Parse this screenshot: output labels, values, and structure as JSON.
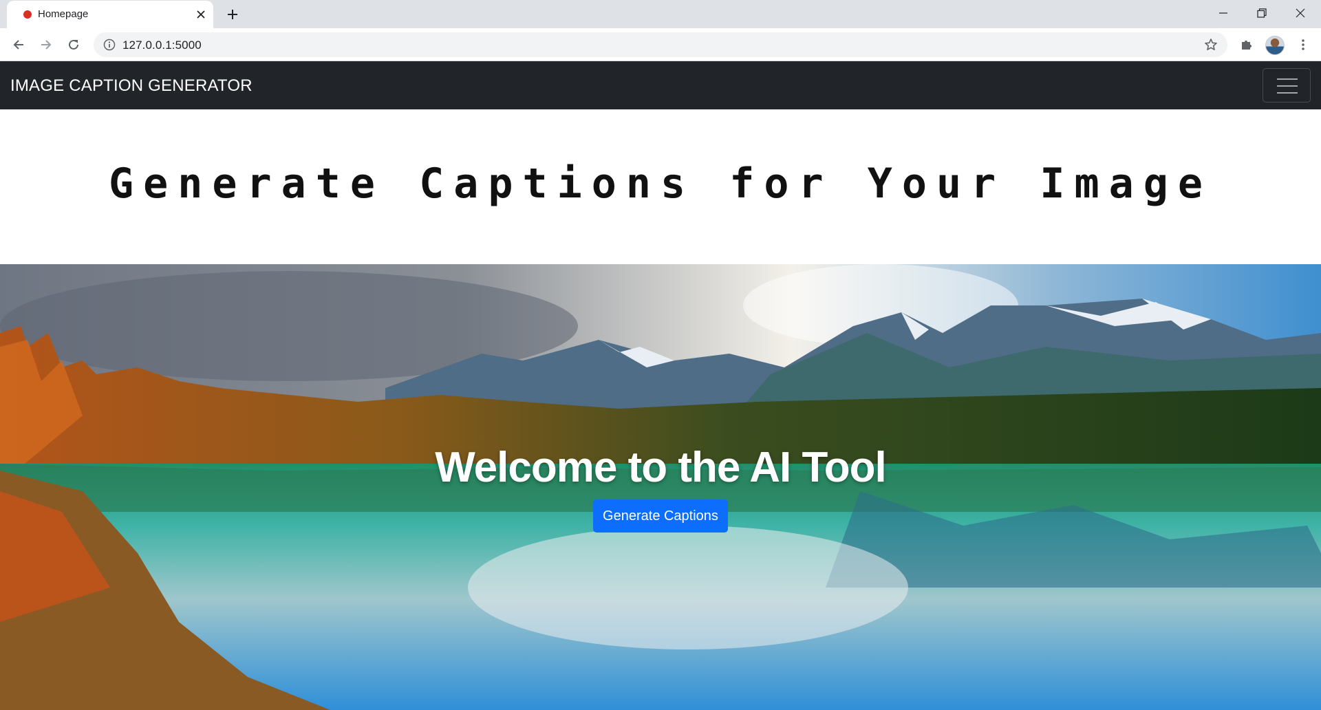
{
  "browser": {
    "tab_title": "Homepage",
    "url": "127.0.0.1:5000"
  },
  "navbar": {
    "brand": "IMAGE CAPTION GENERATOR"
  },
  "main": {
    "heading": "Generate Captions for Your Image"
  },
  "hero": {
    "title": "Welcome to the AI Tool",
    "button_label": "Generate Captions"
  },
  "colors": {
    "navbar_bg": "#212529",
    "button_bg": "#0d6efd",
    "tabstrip_bg": "#dee1e6"
  },
  "icons": {
    "tab_favicon": "red-dot-icon",
    "back": "arrow-left-icon",
    "forward": "arrow-right-icon",
    "reload": "reload-icon",
    "site_info": "info-icon",
    "bookmark": "star-icon",
    "extensions": "puzzle-icon",
    "menu": "kebab-icon"
  }
}
